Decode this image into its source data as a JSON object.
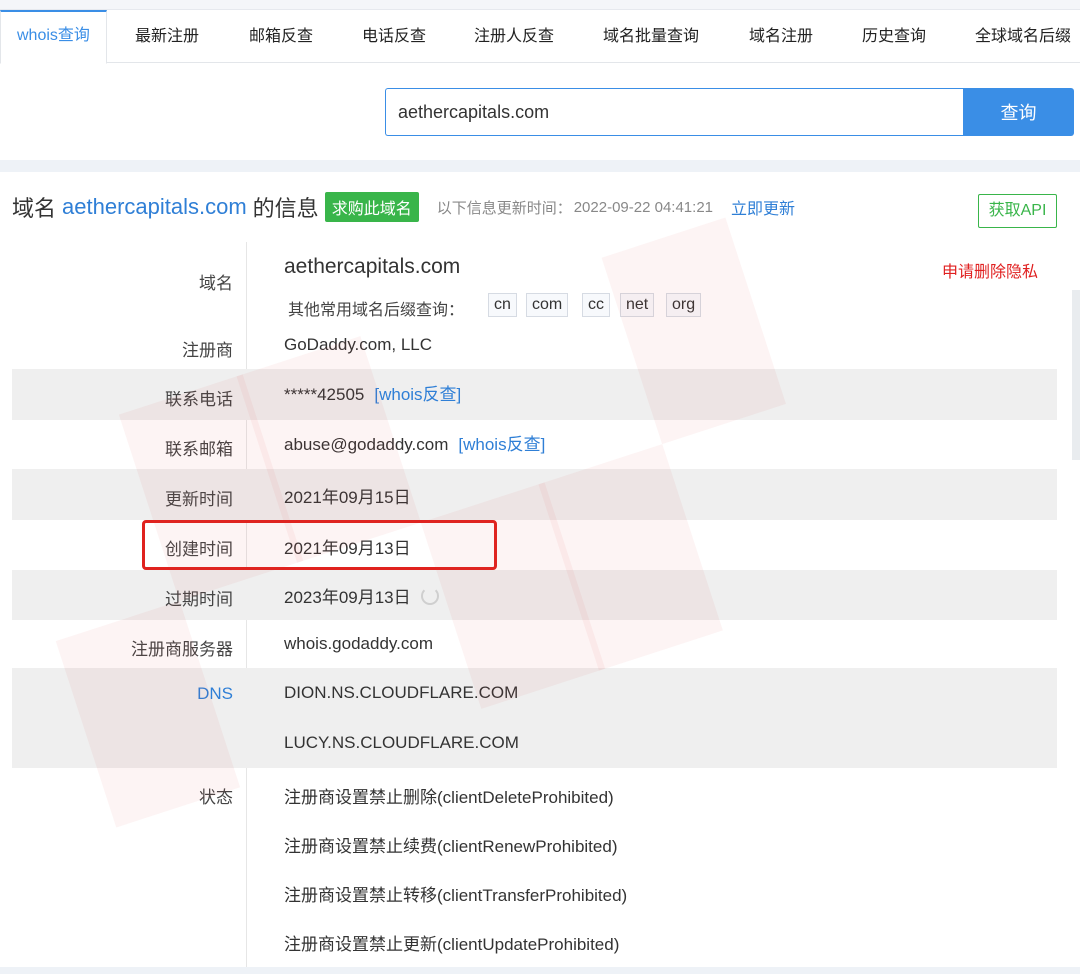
{
  "nav": {
    "tabs": [
      {
        "label": "whois查询",
        "active": true
      },
      {
        "label": "最新注册"
      },
      {
        "label": "邮箱反查"
      },
      {
        "label": "电话反查"
      },
      {
        "label": "注册人反查"
      },
      {
        "label": "域名批量查询"
      },
      {
        "label": "域名注册"
      },
      {
        "label": "历史查询"
      },
      {
        "label": "全球域名后缀"
      }
    ]
  },
  "search": {
    "value": "aethercapitals.com",
    "button_label": "查询"
  },
  "header": {
    "prefix": "域名",
    "domain": "aethercapitals.com",
    "suffix": "的信息",
    "buy_label": "求购此域名",
    "update_label": "以下信息更新时间：",
    "update_time": "2022-09-22 04:41:21",
    "refresh_label": "立即更新",
    "api_label": "获取API"
  },
  "colors": {
    "accent": "#3a8ee6",
    "link": "#2f7fd6",
    "green": "#39b54a",
    "red": "#e02020",
    "highlight": "#e0221e"
  },
  "info": {
    "domain_label": "域名",
    "domain_value": "aethercapitals.com",
    "privacy_label": "申请删除隐私",
    "suffix_label": "其他常用域名后缀查询：",
    "suffixes": [
      "cn",
      "com",
      "cc",
      "net",
      "org"
    ],
    "registrar_label": "注册商",
    "registrar_value": "GoDaddy.com, LLC",
    "phone_label": "联系电话",
    "phone_value": "*****42505",
    "phone_link": "[whois反查]",
    "email_label": "联系邮箱",
    "email_value": "abuse@godaddy.com",
    "email_link": "[whois反查]",
    "updated_label": "更新时间",
    "updated_value": "2021年09月15日",
    "created_label": "创建时间",
    "created_value": "2021年09月13日",
    "expires_label": "过期时间",
    "expires_value": "2023年09月13日",
    "server_label": "注册商服务器",
    "server_value": "whois.godaddy.com",
    "dns_label": "DNS",
    "dns": [
      "DION.NS.CLOUDFLARE.COM",
      "LUCY.NS.CLOUDFLARE.COM"
    ],
    "status_label": "状态",
    "status": [
      "注册商设置禁止删除(clientDeleteProhibited)",
      "注册商设置禁止续费(clientRenewProhibited)",
      "注册商设置禁止转移(clientTransferProhibited)",
      "注册商设置禁止更新(clientUpdateProhibited)"
    ]
  }
}
